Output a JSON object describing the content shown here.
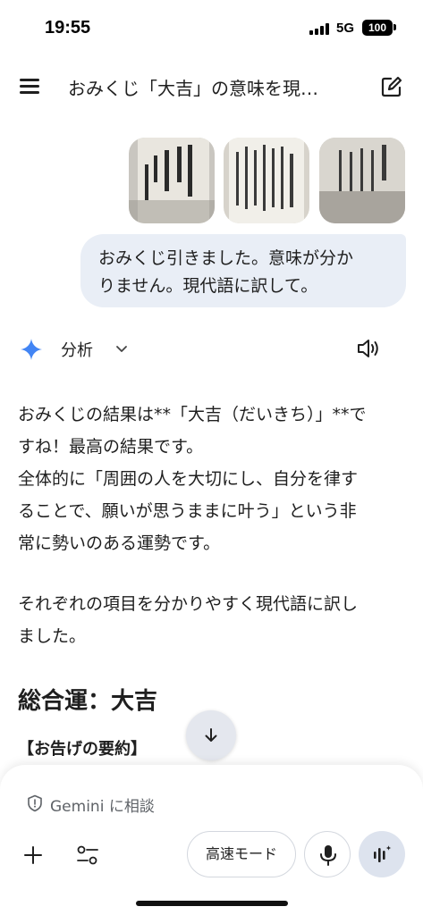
{
  "status_bar": {
    "time": "19:55",
    "network": "5G",
    "battery": "100"
  },
  "header": {
    "title": "おみくじ「大吉」の意味を現…",
    "menu_icon": "hamburger-menu-icon",
    "edit_icon": "new-chat-icon"
  },
  "attachments": [
    {
      "name": "omikuji-photo-1"
    },
    {
      "name": "omikuji-photo-2"
    },
    {
      "name": "omikuji-photo-3"
    }
  ],
  "user_message": {
    "line1": "おみくじ引きました。意味が分か",
    "line2": "りません。現代語に訳して。"
  },
  "analysis": {
    "label": "分析",
    "sparkle_color": "#4285f4"
  },
  "response": {
    "p1_lines": [
      "おみくじの結果は**「大吉（だいきち）」**で",
      "すね！最高の結果です。",
      "全体的に「周囲の人を大切にし、自分を律す",
      "ることで、願いが思うままに叶う」という非",
      "常に勢いのある運勢です。"
    ],
    "p2_lines": [
      "それぞれの項目を分かりやすく現代語に訳し",
      "ました。"
    ],
    "heading": "総合運：大吉",
    "subheading": "【お告げの要約】"
  },
  "composer": {
    "placeholder": "Gemini に相談",
    "mode_label": "高速モード"
  }
}
